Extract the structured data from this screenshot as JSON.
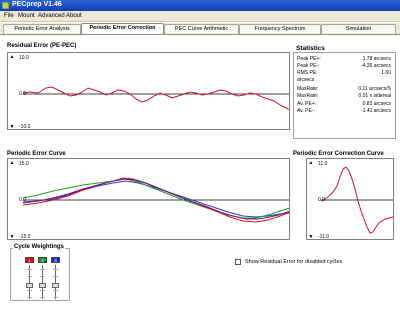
{
  "window": {
    "title": "PECprep V1.46"
  },
  "menu": [
    "File",
    "Mount",
    "Advanced",
    "About"
  ],
  "tabs": [
    "Periodic Error Analysis",
    "Periodic Error Correction",
    "PEC Curve Arithmetic",
    "Frequency Spectrum",
    "Simulation"
  ],
  "active_tab": 1,
  "residual": {
    "title": "Residual Error (PE-PEC)",
    "ymax": "10.0",
    "ymid": "0.0",
    "ymin": "-10.0"
  },
  "statistics": {
    "title": "Statistics",
    "rows": [
      {
        "key": "Peak PE+:",
        "value": "1.78 arcsecs"
      },
      {
        "key": "Peak PE-:",
        "value": "-4.26 arcsecs"
      },
      {
        "key": "RMS PE:",
        "value": "1.60"
      },
      {
        "key": "arcsecs",
        "value": ""
      },
      {
        "key": "MaxRate:",
        "value": "0.11 arcsecs/S"
      },
      {
        "key": "MaxRate:",
        "value": "0.01 x sidereal"
      },
      {
        "key": "Av. PE+:",
        "value": "0.83 arcsecs"
      },
      {
        "key": "Av. PE-:",
        "value": "-1.41 arcsecs"
      }
    ]
  },
  "pe_curve": {
    "title": "Periodic Error Curve",
    "ymax": "15.0",
    "ymid": "0.0",
    "ymin": "-15.0"
  },
  "pec_curve": {
    "title": "Periodic Error Correction Curve",
    "ymax": "11.0",
    "ymid": "0.0",
    "ymin": "-11.0"
  },
  "cycle_weightings": {
    "title": "Cycle Weightings",
    "cycles": [
      {
        "label": "1",
        "color": "#d01010"
      },
      {
        "label": "2",
        "color": "#10a020"
      },
      {
        "label": "3",
        "color": "#1030c0"
      }
    ]
  },
  "show_residual_checkbox": {
    "label": "Show Residual Error for disabled cycles",
    "checked": false
  },
  "colors": {
    "residual_line": "#d0102a",
    "series_red": "#e01010",
    "series_green": "#20a020",
    "series_blue": "#2040d0",
    "series_purple": "#6a1a8a"
  }
}
